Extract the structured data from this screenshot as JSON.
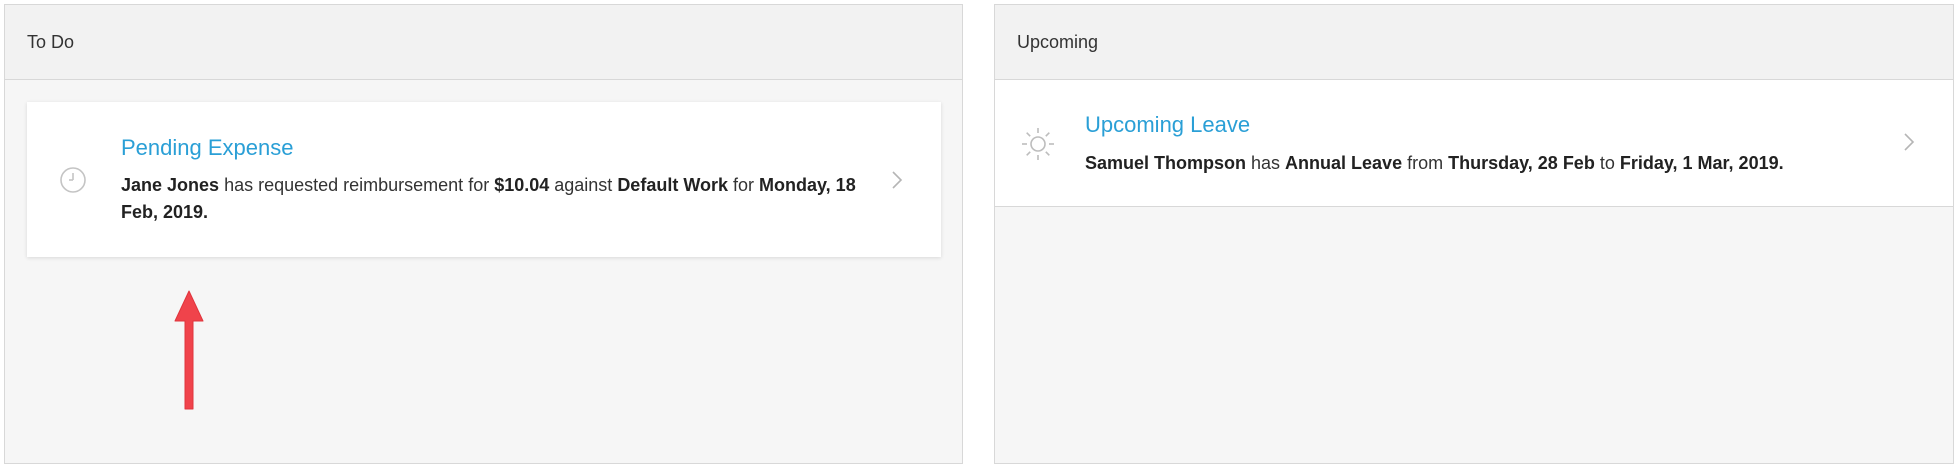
{
  "todo": {
    "header": "To Do",
    "card": {
      "title": "Pending Expense",
      "person": "Jane Jones",
      "text1": " has requested reimbursement for ",
      "amount": "$10.04",
      "text2": " against ",
      "category": "Default Work",
      "text3": " for ",
      "date": "Monday, 18 Feb, 2019.",
      "icon": "clock-icon"
    }
  },
  "upcoming": {
    "header": "Upcoming",
    "card": {
      "title": "Upcoming Leave",
      "person": "Samuel Thompson",
      "text1": " has ",
      "leave_type": "Annual Leave",
      "text2": " from ",
      "start": "Thursday, 28 Feb",
      "text3": " to ",
      "end": "Friday, 1 Mar, 2019.",
      "icon": "sun-icon"
    }
  },
  "colors": {
    "link": "#2a9fd6",
    "arrow": "#f0434b"
  }
}
